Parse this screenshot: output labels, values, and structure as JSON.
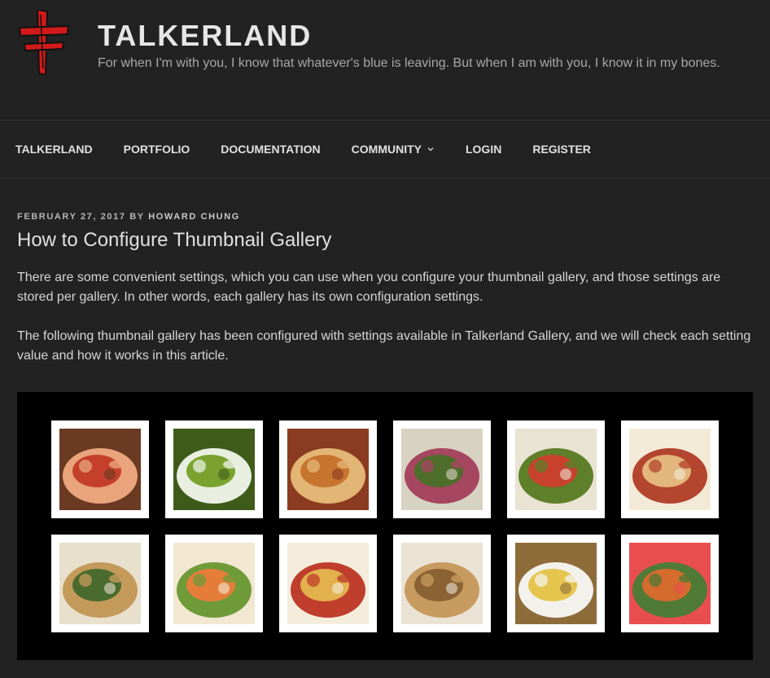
{
  "site": {
    "title": "TALKERLAND",
    "description": "For when I'm with you, I know that whatever's blue is leaving. But when I am with you, I know it in my bones."
  },
  "nav": {
    "items": [
      {
        "label": "TALKERLAND"
      },
      {
        "label": "PORTFOLIO"
      },
      {
        "label": "DOCUMENTATION"
      },
      {
        "label": "COMMUNITY",
        "has_dropdown": true
      },
      {
        "label": "LOGIN"
      },
      {
        "label": "REGISTER"
      }
    ]
  },
  "post": {
    "date": "FEBRUARY 27, 2017",
    "by": "BY",
    "author": "HOWARD CHUNG",
    "title": "How to Configure Thumbnail Gallery",
    "paragraphs": [
      "There are some convenient settings, which you can use when you configure your thumbnail gallery, and those settings are stored per gallery.  In other words, each gallery has its own configuration settings.",
      "The following thumbnail gallery has been configured with settings available in Talkerland Gallery, and we will check each setting value and how it works in this article."
    ]
  },
  "gallery": {
    "thumbnails": [
      {
        "subject": "kimchi on a shell-shaped plate",
        "colors": [
          "#c4402a",
          "#e9a47c",
          "#6b3a22"
        ]
      },
      {
        "subject": "green dumplings in a bowl",
        "colors": [
          "#7aa22e",
          "#e8efe0",
          "#3f5b1a"
        ]
      },
      {
        "subject": "roasted sliced chicken",
        "colors": [
          "#c7742f",
          "#e2b574",
          "#8b3b1f"
        ]
      },
      {
        "subject": "fig salad",
        "colors": [
          "#4f6e2b",
          "#a64660",
          "#d8d2c2"
        ]
      },
      {
        "subject": "tomato olive salad",
        "colors": [
          "#c8412d",
          "#5f7f2a",
          "#e9e3d3"
        ]
      },
      {
        "subject": "pinwheel pastries",
        "colors": [
          "#e2b67c",
          "#b4452e",
          "#f3ead7"
        ]
      },
      {
        "subject": "crab meat on toast",
        "colors": [
          "#4a6b2e",
          "#c49a5b",
          "#e8e0cc"
        ]
      },
      {
        "subject": "shrimp and carrot salad",
        "colors": [
          "#e57d3a",
          "#6f9a38",
          "#f2e7d1"
        ]
      },
      {
        "subject": "noodle bowl",
        "colors": [
          "#e2b04d",
          "#bf3e2c",
          "#f4eddc"
        ]
      },
      {
        "subject": "stir-fried noodles",
        "colors": [
          "#8a6233",
          "#c79a5f",
          "#eae3d4"
        ]
      },
      {
        "subject": "dried noodles and rice",
        "colors": [
          "#e6c54e",
          "#f3f1ec",
          "#8e6c3a"
        ]
      },
      {
        "subject": "colorful nests of pasta",
        "colors": [
          "#d66b2e",
          "#4f7b36",
          "#e94e4e"
        ]
      }
    ]
  }
}
